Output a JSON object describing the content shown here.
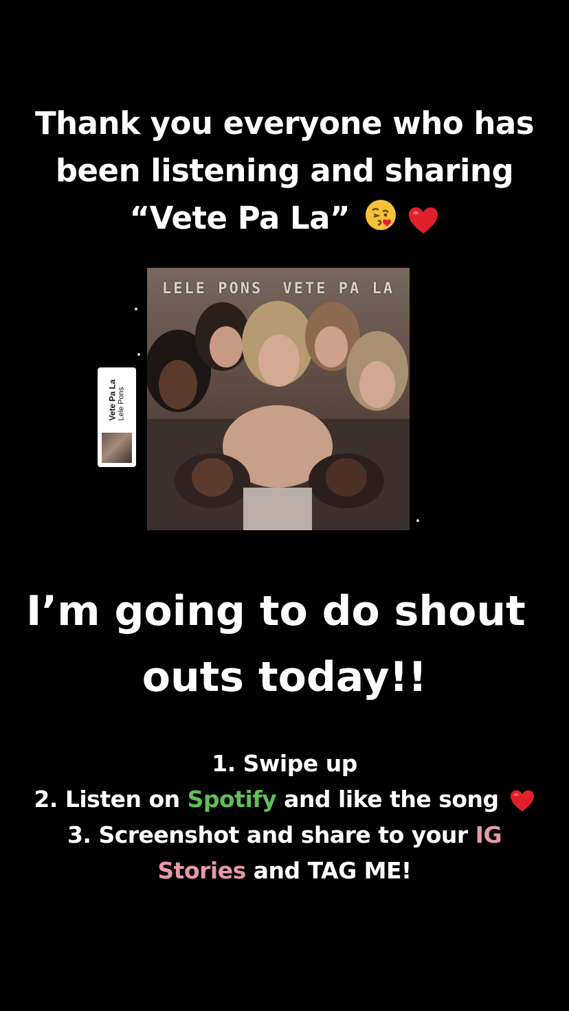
{
  "headline": {
    "line1": "Thank you everyone who has",
    "line2": "been listening and sharing",
    "line3": "“Vete Pa La”",
    "emojis": [
      "kissing-face-emoji",
      "red-heart-emoji"
    ]
  },
  "album": {
    "artist_label": "LELE PONS",
    "title_label": "VETE PA LA"
  },
  "sticker": {
    "song": "Vete Pa La",
    "artist": "Lele Pons"
  },
  "shoutout": {
    "line1": "I’m going to do shout",
    "line2": "outs today!!"
  },
  "steps": {
    "step1": "1. Swipe up",
    "step2_pre": "2. Listen on ",
    "step2_highlight": "Spotify",
    "step2_post": " and like the song",
    "step3_pre": "3. Screenshot and share to your ",
    "step3_highlight_a": "IG",
    "step3_highlight_b": "Stories",
    "step3_post": " and TAG ME!"
  },
  "colors": {
    "background": "#000000",
    "text": "#ffffff",
    "spotify_green": "#5fbf58",
    "ig_pink": "#e69aa6",
    "heart_red": "#e0202a"
  }
}
